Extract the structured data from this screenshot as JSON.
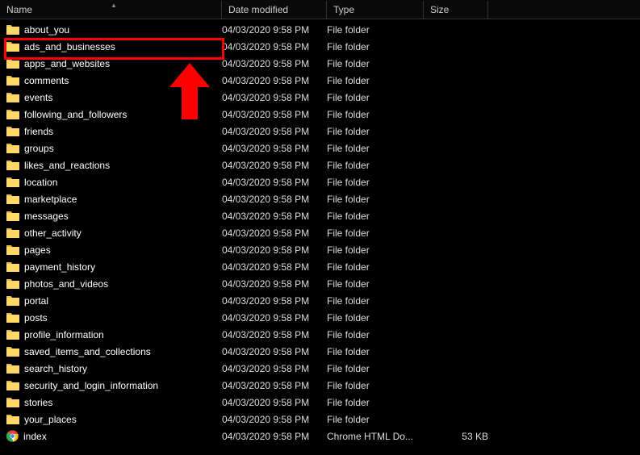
{
  "columns": {
    "name": "Name",
    "date": "Date modified",
    "type": "Type",
    "size": "Size"
  },
  "items": [
    {
      "name": "about_you",
      "date": "04/03/2020 9:58 PM",
      "type": "File folder",
      "size": "",
      "kind": "folder"
    },
    {
      "name": "ads_and_businesses",
      "date": "04/03/2020 9:58 PM",
      "type": "File folder",
      "size": "",
      "kind": "folder"
    },
    {
      "name": "apps_and_websites",
      "date": "04/03/2020 9:58 PM",
      "type": "File folder",
      "size": "",
      "kind": "folder"
    },
    {
      "name": "comments",
      "date": "04/03/2020 9:58 PM",
      "type": "File folder",
      "size": "",
      "kind": "folder"
    },
    {
      "name": "events",
      "date": "04/03/2020 9:58 PM",
      "type": "File folder",
      "size": "",
      "kind": "folder"
    },
    {
      "name": "following_and_followers",
      "date": "04/03/2020 9:58 PM",
      "type": "File folder",
      "size": "",
      "kind": "folder"
    },
    {
      "name": "friends",
      "date": "04/03/2020 9:58 PM",
      "type": "File folder",
      "size": "",
      "kind": "folder"
    },
    {
      "name": "groups",
      "date": "04/03/2020 9:58 PM",
      "type": "File folder",
      "size": "",
      "kind": "folder"
    },
    {
      "name": "likes_and_reactions",
      "date": "04/03/2020 9:58 PM",
      "type": "File folder",
      "size": "",
      "kind": "folder"
    },
    {
      "name": "location",
      "date": "04/03/2020 9:58 PM",
      "type": "File folder",
      "size": "",
      "kind": "folder"
    },
    {
      "name": "marketplace",
      "date": "04/03/2020 9:58 PM",
      "type": "File folder",
      "size": "",
      "kind": "folder"
    },
    {
      "name": "messages",
      "date": "04/03/2020 9:58 PM",
      "type": "File folder",
      "size": "",
      "kind": "folder"
    },
    {
      "name": "other_activity",
      "date": "04/03/2020 9:58 PM",
      "type": "File folder",
      "size": "",
      "kind": "folder"
    },
    {
      "name": "pages",
      "date": "04/03/2020 9:58 PM",
      "type": "File folder",
      "size": "",
      "kind": "folder"
    },
    {
      "name": "payment_history",
      "date": "04/03/2020 9:58 PM",
      "type": "File folder",
      "size": "",
      "kind": "folder"
    },
    {
      "name": "photos_and_videos",
      "date": "04/03/2020 9:58 PM",
      "type": "File folder",
      "size": "",
      "kind": "folder"
    },
    {
      "name": "portal",
      "date": "04/03/2020 9:58 PM",
      "type": "File folder",
      "size": "",
      "kind": "folder"
    },
    {
      "name": "posts",
      "date": "04/03/2020 9:58 PM",
      "type": "File folder",
      "size": "",
      "kind": "folder"
    },
    {
      "name": "profile_information",
      "date": "04/03/2020 9:58 PM",
      "type": "File folder",
      "size": "",
      "kind": "folder"
    },
    {
      "name": "saved_items_and_collections",
      "date": "04/03/2020 9:58 PM",
      "type": "File folder",
      "size": "",
      "kind": "folder"
    },
    {
      "name": "search_history",
      "date": "04/03/2020 9:58 PM",
      "type": "File folder",
      "size": "",
      "kind": "folder"
    },
    {
      "name": "security_and_login_information",
      "date": "04/03/2020 9:58 PM",
      "type": "File folder",
      "size": "",
      "kind": "folder"
    },
    {
      "name": "stories",
      "date": "04/03/2020 9:58 PM",
      "type": "File folder",
      "size": "",
      "kind": "folder"
    },
    {
      "name": "your_places",
      "date": "04/03/2020 9:58 PM",
      "type": "File folder",
      "size": "",
      "kind": "folder"
    },
    {
      "name": "index",
      "date": "04/03/2020 9:58 PM",
      "type": "Chrome HTML Do...",
      "size": "53 KB",
      "kind": "chrome"
    }
  ],
  "highlight_index": 1
}
